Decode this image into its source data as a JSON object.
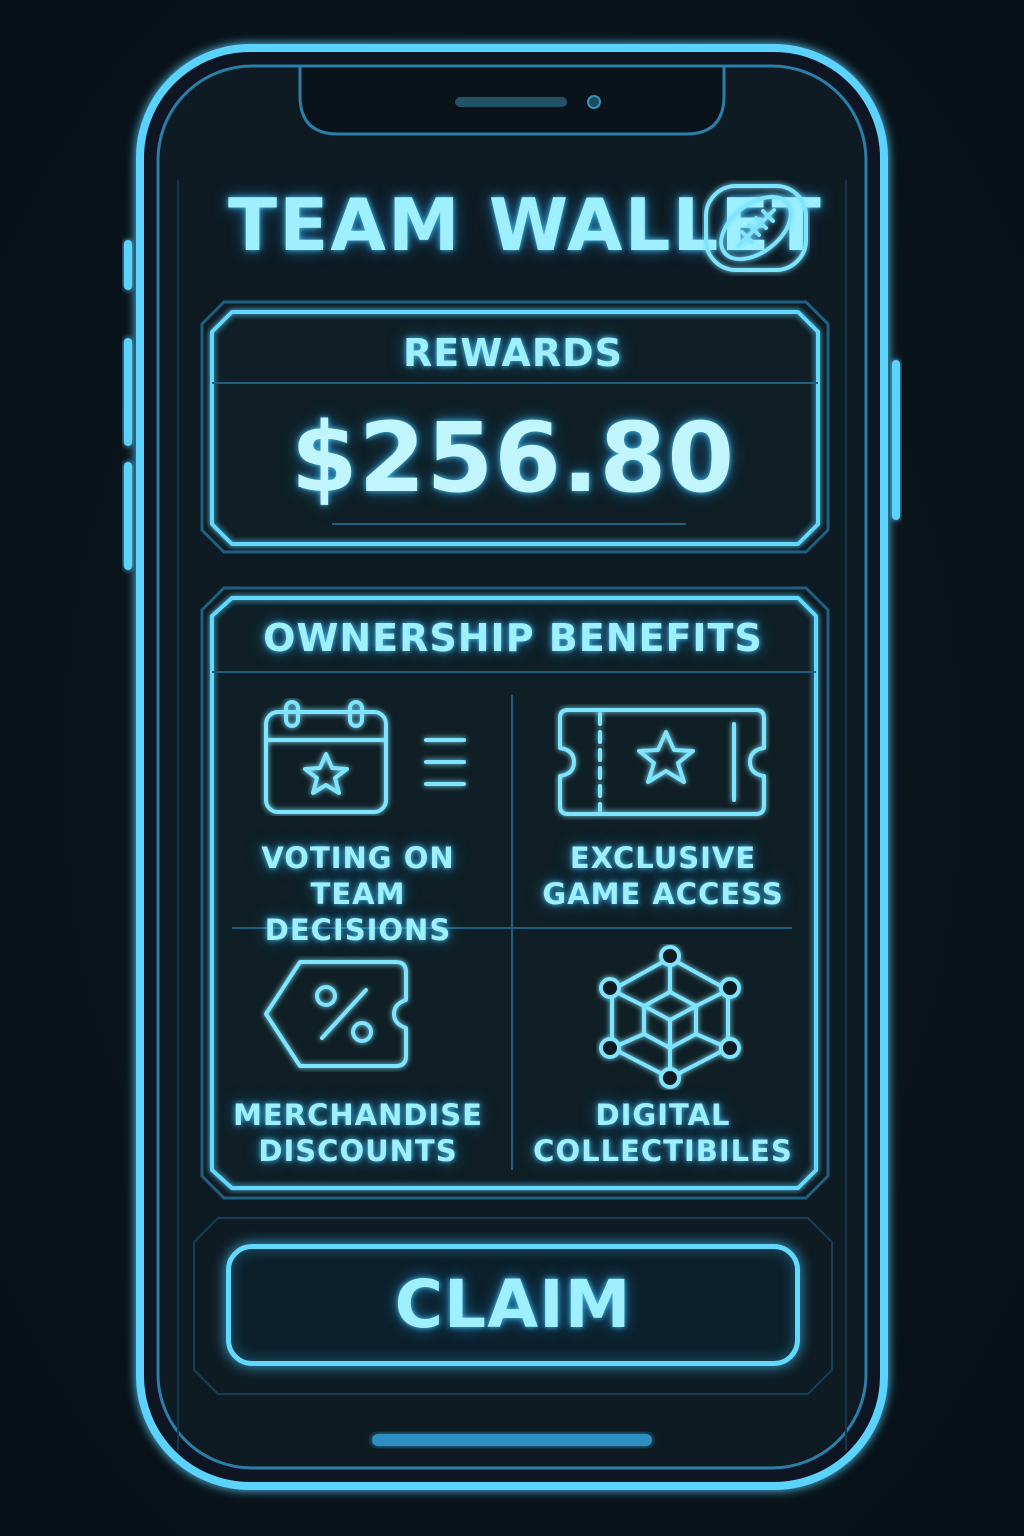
{
  "header": {
    "title": "TEAM WALLET",
    "logo_icon": "football-icon"
  },
  "rewards": {
    "label": "REWARDS",
    "amount": "$256.80"
  },
  "benefits": {
    "label": "OWNERSHIP BENEFITS",
    "items": [
      {
        "label": "VOTING ON\nTEAM DECISIONS",
        "icon": "calendar-star-icon"
      },
      {
        "label": "EXCLUSIVE\nGAME ACCESS",
        "icon": "ticket-star-icon"
      },
      {
        "label": "MERCHANDISE\nDISCOUNTS",
        "icon": "discount-tag-icon"
      },
      {
        "label": "DIGITAL\nCOLLECTIBILES",
        "icon": "network-cube-icon"
      }
    ]
  },
  "actions": {
    "claim_label": "CLAIM"
  },
  "theme": {
    "accent": "#62d8ff",
    "text": "#9ef0ff",
    "background": "#0a141b"
  }
}
